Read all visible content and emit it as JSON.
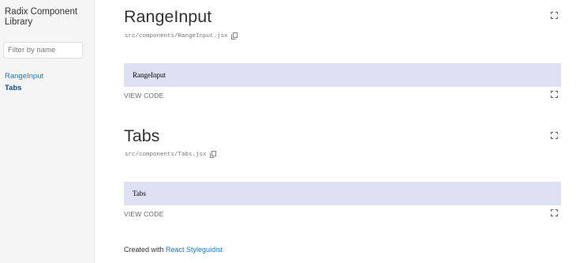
{
  "sidebar": {
    "title": "Radix Component Library",
    "filter_placeholder": "Filter by name",
    "items": [
      {
        "label": "RangeInput",
        "active": false
      },
      {
        "label": "Tabs",
        "active": true
      }
    ]
  },
  "sections": [
    {
      "title": "RangeInput",
      "path": "src/components/RangeInput.jsx",
      "preview_text": "RangeInput",
      "view_code": "VIEW CODE"
    },
    {
      "title": "Tabs",
      "path": "src/components/Tabs.jsx",
      "preview_text": "Tabs",
      "view_code": "VIEW CODE"
    }
  ],
  "footer": {
    "prefix": "Created with ",
    "link": "React Styleguidist"
  },
  "icons": {
    "copy": "copy-icon",
    "fullscreen": "fullscreen-icon"
  },
  "colors": {
    "link": "#1978c8",
    "active_link": "#0a4f84",
    "preview_bg": "#dfe0f3",
    "sidebar_bg": "#f5f5f5"
  }
}
